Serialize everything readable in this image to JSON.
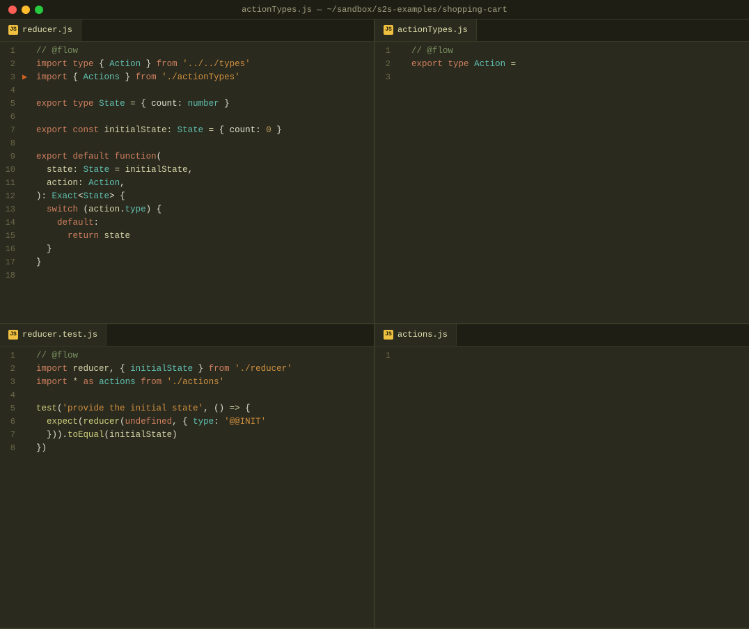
{
  "titlebar": {
    "title": "actionTypes.js — ~/sandbox/s2s-examples/shopping-cart"
  },
  "tabs": {
    "top_left": {
      "label": "reducer.js",
      "icon": "JS",
      "active": true
    },
    "top_right": {
      "label": "actionTypes.js",
      "icon": "JS",
      "active": true
    },
    "bottom_left": {
      "label": "reducer.test.js",
      "icon": "JS",
      "active": true
    },
    "bottom_right": {
      "label": "actions.js",
      "icon": "JS",
      "active": true
    }
  },
  "panes": {
    "top_left_lines": [
      {
        "num": "1",
        "content": "// @flow"
      },
      {
        "num": "2",
        "content": "import type { Action } from '../../types'"
      },
      {
        "num": "3",
        "content": "import { Actions } from './actionTypes'",
        "arrow": true
      },
      {
        "num": "4",
        "content": ""
      },
      {
        "num": "5",
        "content": "export type State = { count: number }"
      },
      {
        "num": "6",
        "content": ""
      },
      {
        "num": "7",
        "content": "export const initialState: State = { count: 0 }"
      },
      {
        "num": "8",
        "content": ""
      },
      {
        "num": "9",
        "content": "export default function("
      },
      {
        "num": "10",
        "content": "  state: State = initialState,"
      },
      {
        "num": "11",
        "content": "  action: Action,"
      },
      {
        "num": "12",
        "content": "): Exact<State> {"
      },
      {
        "num": "13",
        "content": "  switch (action.type) {"
      },
      {
        "num": "14",
        "content": "    default:"
      },
      {
        "num": "15",
        "content": "      return state"
      },
      {
        "num": "16",
        "content": "  }"
      },
      {
        "num": "17",
        "content": "}"
      },
      {
        "num": "18",
        "content": ""
      }
    ],
    "top_right_lines": [
      {
        "num": "1",
        "content": "// @flow"
      },
      {
        "num": "2",
        "content": "export type Action ="
      },
      {
        "num": "3",
        "content": ""
      }
    ],
    "bottom_left_lines": [
      {
        "num": "1",
        "content": "// @flow"
      },
      {
        "num": "2",
        "content": "import reducer, { initialState } from './reducer'"
      },
      {
        "num": "3",
        "content": "import * as actions from './actions'"
      },
      {
        "num": "4",
        "content": ""
      },
      {
        "num": "5",
        "content": "test('provide the initial state', () => {"
      },
      {
        "num": "6",
        "content": "  expect(reducer(undefined, { type: '@@INIT'"
      },
      {
        "num": "7",
        "content": "  })).toEqual(initialState)"
      },
      {
        "num": "8",
        "content": "})"
      }
    ],
    "bottom_right_lines": [
      {
        "num": "1",
        "content": ""
      }
    ]
  }
}
